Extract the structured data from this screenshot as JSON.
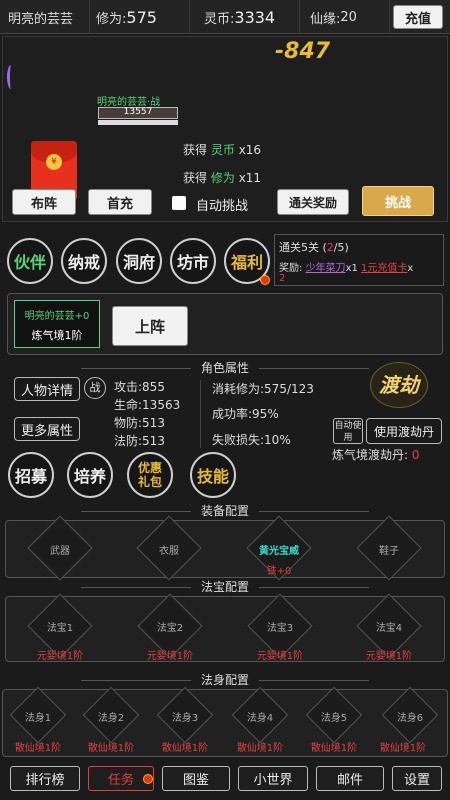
{
  "header": {
    "name": "明亮的芸芸",
    "cultivation_label": "修为:",
    "cultivation_value": "575",
    "coin_label": "灵币:",
    "coin_value": "3334",
    "fate_label": "仙缘:",
    "fate_value": "20",
    "recharge": "充值"
  },
  "battle": {
    "damage": "-847",
    "player_tag": "明亮的芸芸·战",
    "hp": "13557",
    "reward1_prefix": "获得",
    "reward1_item": "灵币",
    "reward1_qty": "x16",
    "reward2_prefix": "获得",
    "reward2_item": "修为",
    "reward2_qty": "x11"
  },
  "actions": {
    "formation": "布阵",
    "first_recharge": "首充",
    "auto_challenge": "自动挑战",
    "clear_reward": "通关奖励",
    "challenge": "挑战"
  },
  "menu": [
    "伙伴",
    "纳戒",
    "洞府",
    "坊市",
    "福利"
  ],
  "stage": {
    "title": "通关5关",
    "progress_current": "2",
    "progress_total": "/5)",
    "progress_open": "(",
    "reward_label": "奖励:",
    "reward1": "少年菜刀",
    "reward1_qty": "x1",
    "reward2": "1元充值卡",
    "reward2_qty": "x",
    "reward2_qty2": "2"
  },
  "partner": {
    "name": "明亮的芸芸+0",
    "realm": "炼气境1阶",
    "deploy": "上阵"
  },
  "attributes": {
    "section": "角色属性",
    "detail_btn": "人物详情",
    "battle_icon": "战",
    "more_btn": "更多属性",
    "attack": "攻击:855",
    "life": "生命:13563",
    "phys_def": "物防:513",
    "magic_def": "法防:513",
    "consume": "消耗修为:575/123",
    "success": "成功率:95%",
    "fail": "失败损失:10%",
    "tribulation": "渡劫",
    "auto_use": "自动使用",
    "use_pill": "使用渡劫丹",
    "pill_label": "炼气境渡劫丹:",
    "pill_count": "0"
  },
  "circles": {
    "recruit": "招募",
    "train": "培养",
    "gift": "优惠礼包",
    "skill": "技能"
  },
  "equipment": {
    "section": "装备配置",
    "slots": [
      "武器",
      "衣服",
      "黄光宝威",
      "鞋子"
    ],
    "equipped_sub": "铁+0"
  },
  "treasure": {
    "section": "法宝配置",
    "slots": [
      "法宝1",
      "法宝2",
      "法宝3",
      "法宝4"
    ],
    "req": "元婴境1阶"
  },
  "bodies": {
    "section": "法身配置",
    "slots": [
      "法身1",
      "法身2",
      "法身3",
      "法身4",
      "法身5",
      "法身6"
    ],
    "req": "散仙境1阶"
  },
  "bottom": [
    "排行榜",
    "任务",
    "图鉴",
    "小世界",
    "邮件",
    "设置"
  ],
  "colors": {
    "gold": "#e8b93c",
    "green": "#5bd37a",
    "red": "#e04040",
    "purple": "#b06ad8",
    "cyan": "#3fd7c8"
  }
}
